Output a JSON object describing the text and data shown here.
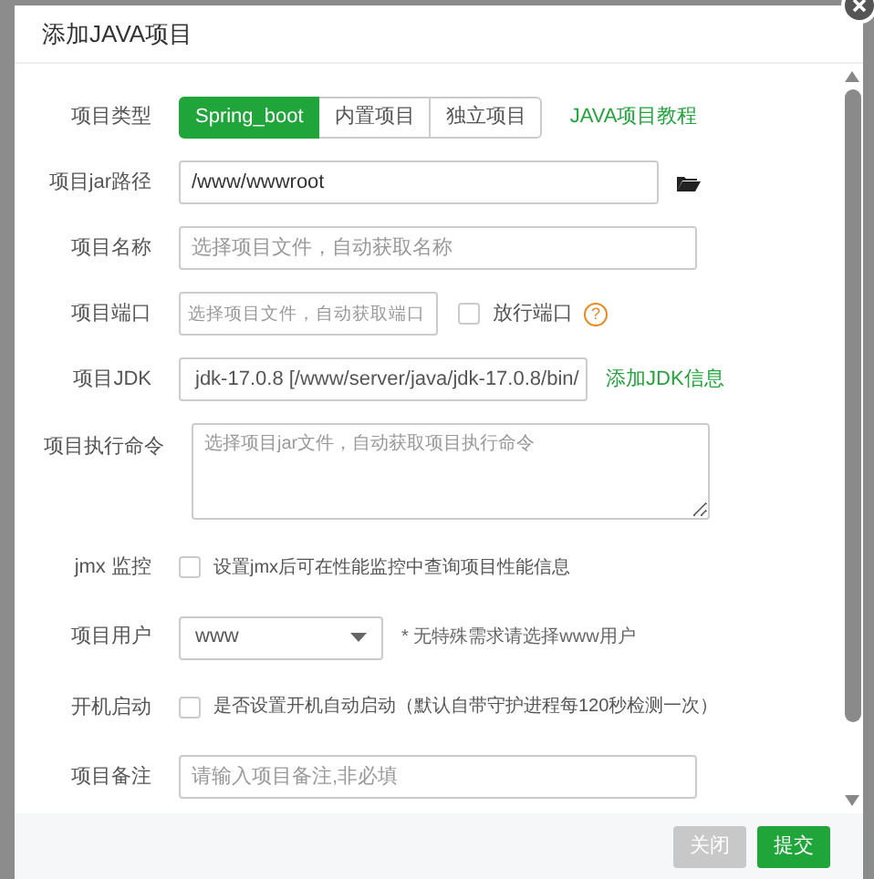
{
  "dialog": {
    "title": "添加JAVA项目"
  },
  "form": [
    {
      "kind": "segmented",
      "label": "项目类型",
      "options": [
        {
          "label": "Spring_boot",
          "selected": true
        },
        {
          "label": "内置项目",
          "selected": false
        },
        {
          "label": "独立项目",
          "selected": false
        }
      ],
      "link": "JAVA项目教程"
    },
    {
      "kind": "path",
      "label": "项目jar路径",
      "value": "/www/wwwroot"
    },
    {
      "kind": "input",
      "label": "项目名称",
      "placeholder": "选择项目文件，自动获取名称"
    },
    {
      "kind": "port",
      "label": "项目端口",
      "placeholder": "选择项目文件，自动获取端口",
      "checkbox": {
        "label": "放行端口",
        "checked": false
      },
      "help": "?"
    },
    {
      "kind": "select",
      "label": "项目JDK",
      "value": "jdk-17.0.8 [/www/server/java/jdk-17.0.8/bin/",
      "link": "添加JDK信息"
    },
    {
      "kind": "textarea",
      "label": "项目执行命令",
      "placeholder": "选择项目jar文件，自动获取项目执行命令"
    },
    {
      "kind": "check",
      "label": "jmx 监控",
      "checked": false,
      "text": "设置jmx后可在性能监控中查询项目性能信息"
    },
    {
      "kind": "select-short",
      "label": "项目用户",
      "value": "www",
      "note": "* 无特殊需求请选择www用户"
    },
    {
      "kind": "check",
      "label": "开机启动",
      "checked": false,
      "text": "是否设置开机自动启动（默认自带守护进程每120秒检测一次）"
    },
    {
      "kind": "input",
      "label": "项目备注",
      "placeholder": "请输入项目备注,非必填"
    }
  ],
  "buttons": [
    {
      "label": "关闭",
      "disabled": true
    },
    {
      "label": "提交",
      "disabled": false
    }
  ]
}
